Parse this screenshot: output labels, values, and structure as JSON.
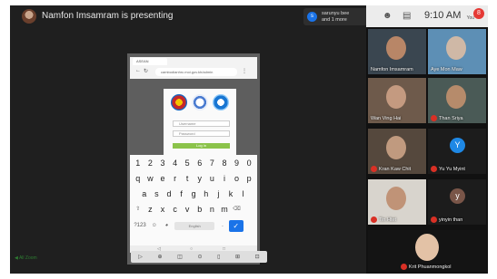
{
  "header": {
    "presenter_text": "Namfon Imsamram is presenting",
    "notification": {
      "avatar_letter": "s",
      "line1": "sarunyu bee",
      "line2": "and 1 more"
    }
  },
  "status_bar": {
    "time": "9:10 AM",
    "small_text": "You",
    "badge": "8"
  },
  "shared_screen": {
    "tab_label": "ASEAN",
    "url": "cambodianhrc.moi.gov.kh/admin",
    "login_fields": [
      "Username",
      "Password"
    ],
    "login_button": "Log in",
    "keyboard": {
      "numbers": [
        "1",
        "2",
        "3",
        "4",
        "5",
        "6",
        "7",
        "8",
        "9",
        "0"
      ],
      "row1": [
        "q",
        "w",
        "e",
        "r",
        "t",
        "y",
        "u",
        "i",
        "o",
        "p"
      ],
      "row2": [
        "a",
        "s",
        "d",
        "f",
        "g",
        "h",
        "j",
        "k",
        "l"
      ],
      "row3": [
        "z",
        "x",
        "c",
        "v",
        "b",
        "n",
        "m"
      ],
      "bottom": {
        "sym": "?123",
        "space": "English",
        "enter": "✓"
      }
    },
    "android_nav": [
      "◁",
      "○",
      "□"
    ]
  },
  "host_controls": [
    "▷",
    "⊕",
    "◫",
    "⊙",
    "▯",
    "⊞",
    "⊡"
  ],
  "screen_label": "◀ All Zoom",
  "participants": [
    {
      "name": "Namfon Imsamram",
      "muted": false,
      "bg": "#3a4650",
      "face": "#b88667"
    },
    {
      "name": "Aye Mon Maw",
      "muted": false,
      "bg": "#5d8fb5",
      "face": "#cfb8a6"
    },
    {
      "name": "Wan Ving Hai",
      "muted": false,
      "bg": "#6e5a4b",
      "face": "#c49a80"
    },
    {
      "name": "Than Sriya",
      "muted": true,
      "bg": "#4a5a56",
      "face": "#b68b6b"
    },
    {
      "name": "Kran Kaw Chit",
      "muted": true,
      "bg": "#55483d",
      "face": "#c09a7f"
    },
    {
      "name": "Yu Yu Myint",
      "muted": true,
      "letter": "Y",
      "letter_color": "#1e88e5"
    },
    {
      "name": "Tin Htet",
      "muted": true,
      "bg": "#d8d4cd",
      "face": "#c09377"
    },
    {
      "name": "yinyin than",
      "muted": true,
      "letter": "y",
      "letter_color": "#795548"
    },
    {
      "name": "Krit Phuanmongkol",
      "muted": true,
      "bg": "#141414",
      "face": "#e3c2a6"
    }
  ]
}
